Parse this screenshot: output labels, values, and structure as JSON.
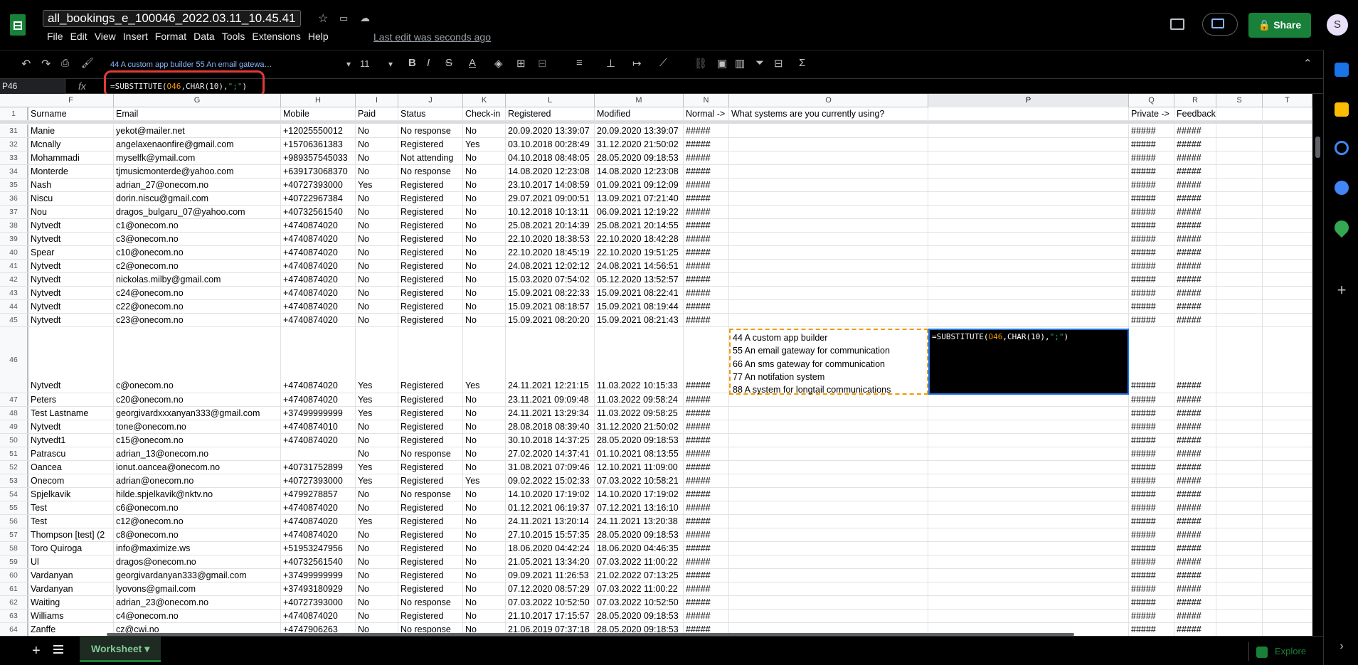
{
  "app": {
    "doc_title": "all_bookings_e_100046_2022.03.11_10.45.41",
    "menu": [
      "File",
      "Edit",
      "View",
      "Insert",
      "Format",
      "Data",
      "Tools",
      "Extensions",
      "Help"
    ],
    "last_edit": "Last edit was seconds ago",
    "share_label": "Share",
    "avatar_letter": "S"
  },
  "toolbar": {
    "cell_preview": "44 A custom app builder 55 An email gatewa…",
    "font_size": "11",
    "bold": "B",
    "italic": "I",
    "strike": "S",
    "text_color": "A",
    "sum": "Σ"
  },
  "formula_bar": {
    "name_box": "P46",
    "fx": "fx",
    "formula_prefix": "=SUBSTITUTE(",
    "formula_ref": "O46",
    "formula_mid": ",CHAR(10),",
    "formula_str": "\";\"",
    "formula_suffix": ")"
  },
  "columns": [
    "F",
    "G",
    "H",
    "I",
    "J",
    "K",
    "L",
    "M",
    "N",
    "O",
    "P",
    "Q",
    "R",
    "S",
    "T"
  ],
  "header_row": {
    "num": "1",
    "cells": [
      "Surname",
      "Email",
      "Mobile",
      "Paid",
      "Status",
      "Check-in",
      "Registered",
      "Modified",
      "Normal ->",
      "What systems are you currently using?",
      "",
      "Private ->",
      "Feedback ->",
      "",
      ""
    ]
  },
  "rows": [
    {
      "num": "31",
      "cells": [
        "Manie",
        "yekot@mailer.net",
        "+12025550012",
        "No",
        "No response",
        "No",
        "20.09.2020 13:39:07",
        "20.09.2020 13:39:07",
        "#####",
        "",
        "",
        "#####",
        "#####",
        "",
        ""
      ]
    },
    {
      "num": "32",
      "cells": [
        "Mcnally",
        "angelaxenaonfire@gmail.com",
        "+15706361383",
        "No",
        "Registered",
        "Yes",
        "03.10.2018 00:28:49",
        "31.12.2020 21:50:02",
        "#####",
        "",
        "",
        "#####",
        "#####",
        "",
        ""
      ]
    },
    {
      "num": "33",
      "cells": [
        "Mohammadi",
        "myselfk@ymail.com",
        "+989357545033",
        "No",
        "Not attending",
        "No",
        "04.10.2018 08:48:05",
        "28.05.2020 09:18:53",
        "#####",
        "",
        "",
        "#####",
        "#####",
        "",
        ""
      ]
    },
    {
      "num": "34",
      "cells": [
        "Monterde",
        "tjmusicmonterde@yahoo.com",
        "+639173068370",
        "No",
        "No response",
        "No",
        "14.08.2020 12:23:08",
        "14.08.2020 12:23:08",
        "#####",
        "",
        "",
        "#####",
        "#####",
        "",
        ""
      ]
    },
    {
      "num": "35",
      "cells": [
        "Nash",
        "adrian_27@onecom.no",
        "+40727393000",
        "Yes",
        "Registered",
        "No",
        "23.10.2017 14:08:59",
        "01.09.2021 09:12:09",
        "#####",
        "",
        "",
        "#####",
        "#####",
        "",
        ""
      ]
    },
    {
      "num": "36",
      "cells": [
        "Niscu",
        "dorin.niscu@gmail.com",
        "+40722967384",
        "No",
        "Registered",
        "No",
        "29.07.2021 09:00:51",
        "13.09.2021 07:21:40",
        "#####",
        "",
        "",
        "#####",
        "#####",
        "",
        ""
      ]
    },
    {
      "num": "37",
      "cells": [
        "Nou",
        "dragos_bulgaru_07@yahoo.com",
        "+40732561540",
        "No",
        "Registered",
        "No",
        "10.12.2018 10:13:11",
        "06.09.2021 12:19:22",
        "#####",
        "",
        "",
        "#####",
        "#####",
        "",
        ""
      ]
    },
    {
      "num": "38",
      "cells": [
        "Nytvedt",
        "c1@onecom.no",
        "+4740874020",
        "No",
        "Registered",
        "No",
        "25.08.2021 20:14:39",
        "25.08.2021 20:14:55",
        "#####",
        "",
        "",
        "#####",
        "#####",
        "",
        ""
      ]
    },
    {
      "num": "39",
      "cells": [
        "Nytvedt",
        "c3@onecom.no",
        "+4740874020",
        "No",
        "Registered",
        "No",
        "22.10.2020 18:38:53",
        "22.10.2020 18:42:28",
        "#####",
        "",
        "",
        "#####",
        "#####",
        "",
        ""
      ]
    },
    {
      "num": "40",
      "cells": [
        "Spear",
        "c10@onecom.no",
        "+4740874020",
        "No",
        "Registered",
        "No",
        "22.10.2020 18:45:19",
        "22.10.2020 19:51:25",
        "#####",
        "",
        "",
        "#####",
        "#####",
        "",
        ""
      ]
    },
    {
      "num": "41",
      "cells": [
        "Nytvedt",
        "c2@onecom.no",
        "+4740874020",
        "No",
        "Registered",
        "No",
        "24.08.2021 12:02:12",
        "24.08.2021 14:56:51",
        "#####",
        "",
        "",
        "#####",
        "#####",
        "",
        ""
      ]
    },
    {
      "num": "42",
      "cells": [
        "Nytvedt",
        "nickolas.milby@gmail.com",
        "+4740874020",
        "No",
        "Registered",
        "No",
        "15.03.2020 07:54:02",
        "05.12.2020 13:52:57",
        "#####",
        "",
        "",
        "#####",
        "#####",
        "",
        ""
      ]
    },
    {
      "num": "43",
      "cells": [
        "Nytvedt",
        "c24@onecom.no",
        "+4740874020",
        "No",
        "Registered",
        "No",
        "15.09.2021 08:22:33",
        "15.09.2021 08:22:41",
        "#####",
        "",
        "",
        "#####",
        "#####",
        "",
        ""
      ]
    },
    {
      "num": "44",
      "cells": [
        "Nytvedt",
        "c22@onecom.no",
        "+4740874020",
        "No",
        "Registered",
        "No",
        "15.09.2021 08:18:57",
        "15.09.2021 08:19:44",
        "#####",
        "",
        "",
        "#####",
        "#####",
        "",
        ""
      ]
    },
    {
      "num": "45",
      "cells": [
        "Nytvedt",
        "c23@onecom.no",
        "+4740874020",
        "No",
        "Registered",
        "No",
        "15.09.2021 08:20:20",
        "15.09.2021 08:21:43",
        "#####",
        "",
        "",
        "#####",
        "#####",
        "",
        ""
      ]
    }
  ],
  "row46": {
    "num": "46",
    "cells": [
      "Nytvedt",
      "c@onecom.no",
      "+4740874020",
      "Yes",
      "Registered",
      "Yes",
      "24.11.2021 12:21:15",
      "11.03.2022 10:15:33",
      "#####",
      "",
      "",
      "#####",
      "#####",
      "",
      ""
    ],
    "o_lines": [
      "44 A custom app builder",
      "55 An email gateway for communication",
      "66 An sms gateway for communication",
      "77 An notifation system",
      "88 A system for longtail communications"
    ]
  },
  "rows_after": [
    {
      "num": "47",
      "cells": [
        "Peters",
        "c20@onecom.no",
        "+4740874020",
        "Yes",
        "Registered",
        "No",
        "23.11.2021 09:09:48",
        "11.03.2022 09:58:24",
        "#####",
        "",
        "",
        "#####",
        "#####",
        "",
        ""
      ]
    },
    {
      "num": "48",
      "cells": [
        "Test Lastname",
        "georgivardxxxanyan333@gmail.com",
        "+37499999999",
        "Yes",
        "Registered",
        "No",
        "24.11.2021 13:29:34",
        "11.03.2022 09:58:25",
        "#####",
        "",
        "",
        "#####",
        "#####",
        "",
        ""
      ]
    },
    {
      "num": "49",
      "cells": [
        "Nytvedt",
        "tone@onecom.no",
        "+4740874010",
        "No",
        "Registered",
        "No",
        "28.08.2018 08:39:40",
        "31.12.2020 21:50:02",
        "#####",
        "",
        "",
        "#####",
        "#####",
        "",
        ""
      ]
    },
    {
      "num": "50",
      "cells": [
        "Nytvedt1",
        "c15@onecom.no",
        "+4740874020",
        "No",
        "Registered",
        "No",
        "30.10.2018 14:37:25",
        "28.05.2020 09:18:53",
        "#####",
        "",
        "",
        "#####",
        "#####",
        "",
        ""
      ]
    },
    {
      "num": "51",
      "cells": [
        "Patrascu",
        "adrian_13@onecom.no",
        "",
        "No",
        "No response",
        "No",
        "27.02.2020 14:37:41",
        "01.10.2021 08:13:55",
        "#####",
        "",
        "",
        "#####",
        "#####",
        "",
        ""
      ]
    },
    {
      "num": "52",
      "cells": [
        "Oancea",
        "ionut.oancea@onecom.no",
        "+40731752899",
        "Yes",
        "Registered",
        "No",
        "31.08.2021 07:09:46",
        "12.10.2021 11:09:00",
        "#####",
        "",
        "",
        "#####",
        "#####",
        "",
        ""
      ]
    },
    {
      "num": "53",
      "cells": [
        "Onecom",
        "adrian@onecom.no",
        "+40727393000",
        "Yes",
        "Registered",
        "Yes",
        "09.02.2022 15:02:33",
        "07.03.2022 10:58:21",
        "#####",
        "",
        "",
        "#####",
        "#####",
        "",
        ""
      ]
    },
    {
      "num": "54",
      "cells": [
        "Spjelkavik",
        "hilde.spjelkavik@nktv.no",
        "+4799278857",
        "No",
        "No response",
        "No",
        "14.10.2020 17:19:02",
        "14.10.2020 17:19:02",
        "#####",
        "",
        "",
        "#####",
        "#####",
        "",
        ""
      ]
    },
    {
      "num": "55",
      "cells": [
        "Test",
        "c6@onecom.no",
        "+4740874020",
        "No",
        "Registered",
        "No",
        "01.12.2021 06:19:37",
        "07.12.2021 13:16:10",
        "#####",
        "",
        "",
        "#####",
        "#####",
        "",
        ""
      ]
    },
    {
      "num": "56",
      "cells": [
        "Test",
        "c12@onecom.no",
        "+4740874020",
        "Yes",
        "Registered",
        "No",
        "24.11.2021 13:20:14",
        "24.11.2021 13:20:38",
        "#####",
        "",
        "",
        "#####",
        "#####",
        "",
        ""
      ]
    },
    {
      "num": "57",
      "cells": [
        "Thompson [test] (2",
        "c8@onecom.no",
        "+4740874020",
        "No",
        "Registered",
        "No",
        "27.10.2015 15:57:35",
        "28.05.2020 09:18:53",
        "#####",
        "",
        "",
        "#####",
        "#####",
        "",
        ""
      ]
    },
    {
      "num": "58",
      "cells": [
        "Toro Quiroga",
        "info@maximize.ws",
        "+51953247956",
        "No",
        "Registered",
        "No",
        "18.06.2020 04:42:24",
        "18.06.2020 04:46:35",
        "#####",
        "",
        "",
        "#####",
        "#####",
        "",
        ""
      ]
    },
    {
      "num": "59",
      "cells": [
        "Ul",
        "dragos@onecom.no",
        "+40732561540",
        "No",
        "Registered",
        "No",
        "21.05.2021 13:34:20",
        "07.03.2022 11:00:22",
        "#####",
        "",
        "",
        "#####",
        "#####",
        "",
        ""
      ]
    },
    {
      "num": "60",
      "cells": [
        "Vardanyan",
        "georgivardanyan333@gmail.com",
        "+37499999999",
        "No",
        "Registered",
        "No",
        "09.09.2021 11:26:53",
        "21.02.2022 07:13:25",
        "#####",
        "",
        "",
        "#####",
        "#####",
        "",
        ""
      ]
    },
    {
      "num": "61",
      "cells": [
        "Vardanyan",
        "lyovons@gmail.com",
        "+37493180929",
        "No",
        "Registered",
        "No",
        "07.12.2020 08:57:29",
        "07.03.2022 11:00:22",
        "#####",
        "",
        "",
        "#####",
        "#####",
        "",
        ""
      ]
    },
    {
      "num": "62",
      "cells": [
        "Waiting",
        "adrian_23@onecom.no",
        "+40727393000",
        "No",
        "No response",
        "No",
        "07.03.2022 10:52:50",
        "07.03.2022 10:52:50",
        "#####",
        "",
        "",
        "#####",
        "#####",
        "",
        ""
      ]
    },
    {
      "num": "63",
      "cells": [
        "Williams",
        "c4@onecom.no",
        "+4740874020",
        "No",
        "Registered",
        "No",
        "21.10.2017 17:15:57",
        "28.05.2020 09:18:53",
        "#####",
        "",
        "",
        "#####",
        "#####",
        "",
        ""
      ]
    },
    {
      "num": "64",
      "cells": [
        "Zanffe",
        "cz@cwi.no",
        "+4747906263",
        "No",
        "No response",
        "No",
        "21.06.2019 07:37:18",
        "28.05.2020 09:18:53",
        "#####",
        "",
        "",
        "#####",
        "#####",
        "",
        ""
      ]
    }
  ],
  "bottom": {
    "sheet_tab": "Worksheet",
    "explore": "Explore"
  }
}
